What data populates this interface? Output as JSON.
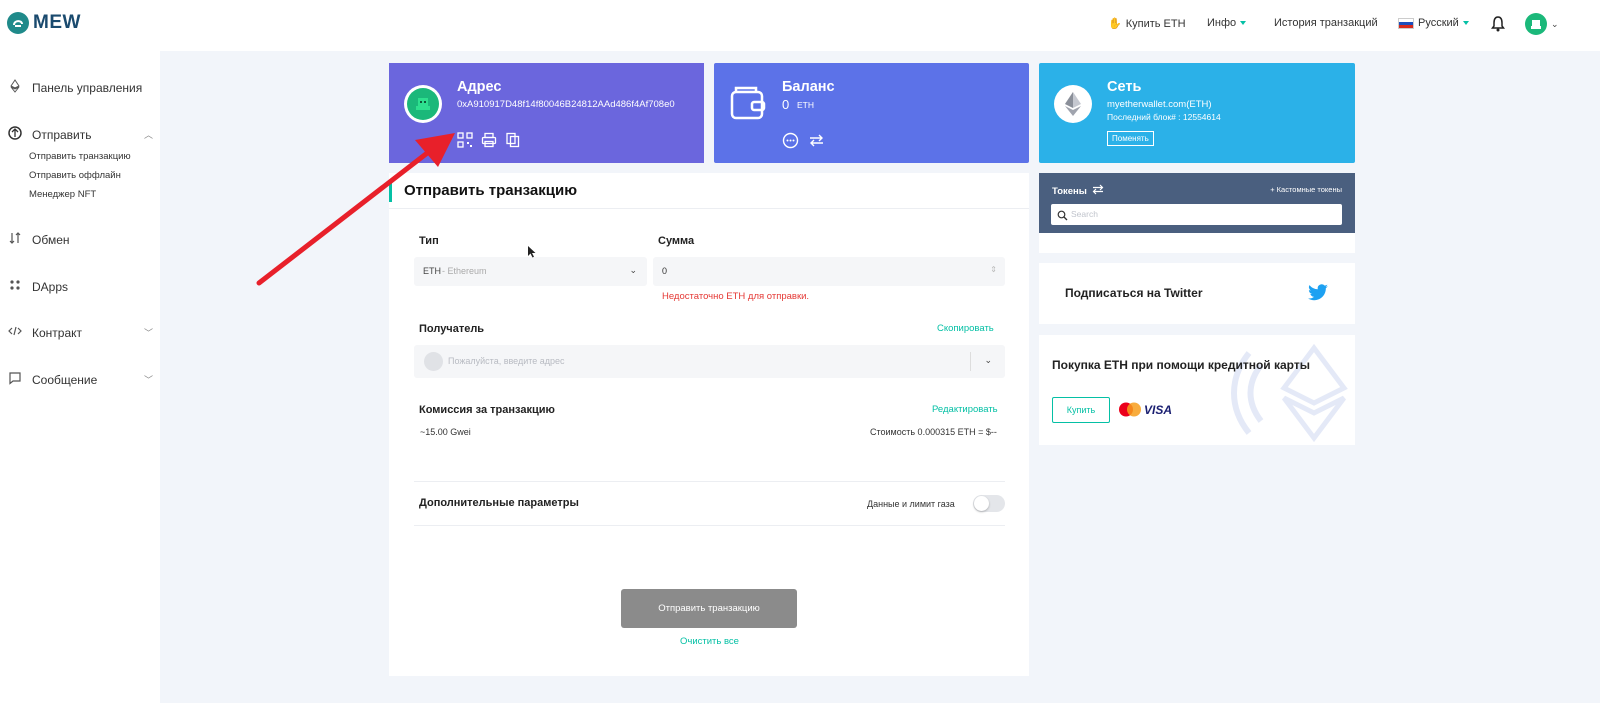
{
  "brand": {
    "name": "MEW"
  },
  "topnav": {
    "buy_eth": "Купить ETH",
    "info": "Инфо",
    "history": "История транзакций",
    "language": "Русский"
  },
  "sidebar": {
    "dashboard": "Панель управления",
    "send": "Отправить",
    "send_sub": [
      "Отправить транзакцию",
      "Отправить оффлайн",
      "Менеджер NFT"
    ],
    "swap": "Обмен",
    "dapps": "DApps",
    "contract": "Контракт",
    "message": "Сообщение"
  },
  "address_card": {
    "title": "Адрес",
    "address": "0xA910917D48f14f80046B24812AAd486f4Af708e0",
    "color": "#6b66dd"
  },
  "balance_card": {
    "title": "Баланс",
    "amount": "0",
    "unit": "ETH",
    "color": "#5c72e8"
  },
  "network_card": {
    "title": "Сеть",
    "network": "myetherwallet.com(ETH)",
    "last_block": "Последний блок# : 12554614",
    "change_button": "Поменять",
    "color": "#2bb1e8"
  },
  "send_form": {
    "heading": "Отправить транзакцию",
    "type_label": "Тип",
    "type_value": "ETH",
    "type_value_sub": " - Ethereum",
    "amount_label": "Сумма",
    "amount_value": "0",
    "error_text": "Недостаточно ETH для отправки.",
    "recipient_label": "Получатель",
    "copy_link": "Скопировать",
    "recipient_placeholder": "Пожалуйста, введите адрес",
    "fee_label": "Комиссия за транзакцию",
    "edit_link": "Редактировать",
    "fee_gwei": "~15.00 Gwei",
    "fee_cost": "Стоимость 0.000315 ETH = $--",
    "advanced_label": "Дополнительные параметры",
    "gas_toggle_label": "Данные и лимит газа",
    "send_button": "Отправить транзакцию",
    "clear_link": "Очистить все"
  },
  "tokens": {
    "title": "Токены",
    "custom_link": "+ Кастомные токены",
    "search_placeholder": "Search"
  },
  "twitter": {
    "text": "Подписаться на Twitter"
  },
  "buy_card": {
    "title": "Покупка ETH при помощи кредитной карты",
    "button": "Купить",
    "visa": "VISA"
  },
  "colors": {
    "accent": "#05c0a5",
    "error": "#e53935",
    "tokens_header": "#4a5f7f"
  }
}
